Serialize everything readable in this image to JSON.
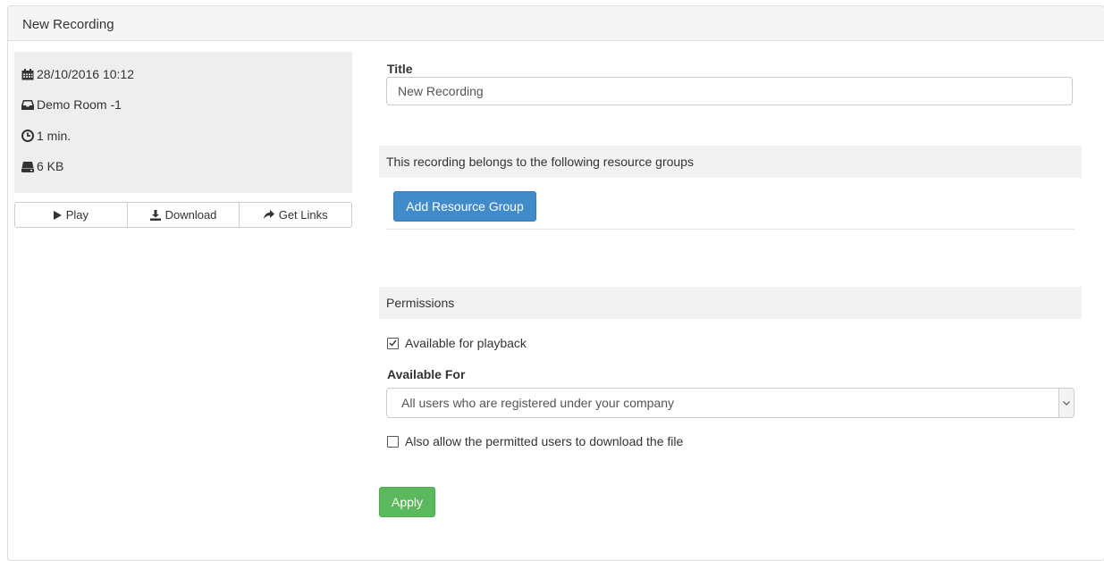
{
  "panel": {
    "title": "New Recording"
  },
  "info": {
    "date": {
      "icon": "calendar-icon",
      "text": "28/10/2016 10:12"
    },
    "room": {
      "icon": "inbox-icon",
      "text": "Demo Room -1"
    },
    "duration": {
      "icon": "clock-icon",
      "text": "1 min."
    },
    "size": {
      "icon": "hard-drive-icon",
      "text": "6 KB"
    }
  },
  "actions": {
    "play": {
      "icon": "play-icon",
      "label": "Play"
    },
    "download": {
      "icon": "download-icon",
      "label": "Download"
    },
    "get_links": {
      "icon": "share-arrow-icon",
      "label": "Get Links"
    }
  },
  "form": {
    "title_label": "Title",
    "title_value": "New Recording",
    "resource_groups_heading": "This recording belongs to the following resource groups",
    "add_resource_group_label": "Add Resource Group",
    "permissions_heading": "Permissions",
    "available_for_playback": {
      "label": "Available for playback",
      "checked": true
    },
    "available_for_label": "Available For",
    "available_for_value": "All users who are registered under your company",
    "allow_download": {
      "label": "Also allow the permitted users to download the file",
      "checked": false
    },
    "apply_label": "Apply"
  },
  "colors": {
    "primary": "#428bca",
    "success": "#5cb85c",
    "info_box_bg": "#eeeeee",
    "section_bar_bg": "#f2f2f2"
  }
}
